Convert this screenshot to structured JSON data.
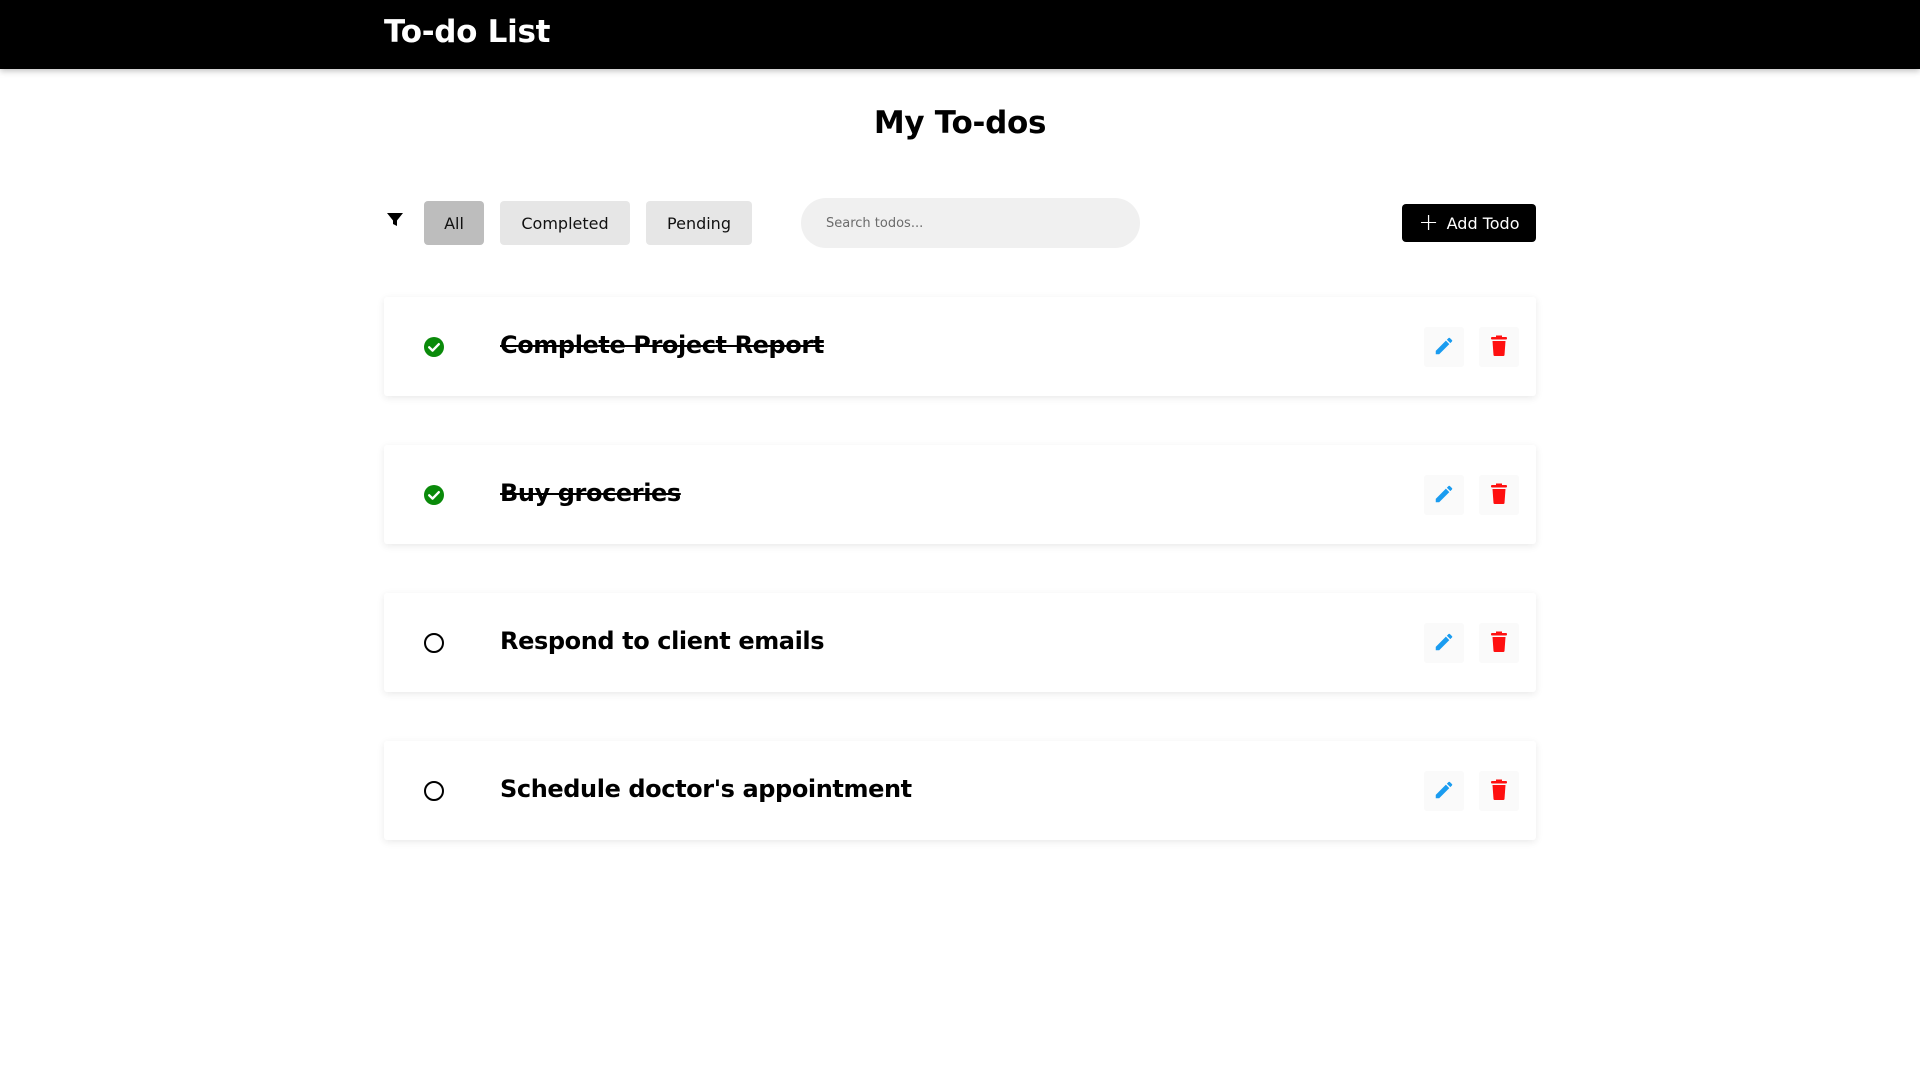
{
  "header": {
    "title": "To-do List"
  },
  "page": {
    "title": "My To-dos"
  },
  "toolbar": {
    "filter_icon": "filter-icon",
    "filters": [
      {
        "label": "All",
        "active": true
      },
      {
        "label": "Completed",
        "active": false
      },
      {
        "label": "Pending",
        "active": false
      }
    ],
    "search": {
      "placeholder": "Search todos...",
      "value": ""
    },
    "add_button": {
      "label": "Add Todo",
      "icon": "plus-icon"
    }
  },
  "todos": [
    {
      "text": "Complete Project Report",
      "completed": true
    },
    {
      "text": "Buy groceries",
      "completed": true
    },
    {
      "text": "Respond to client emails",
      "completed": false
    },
    {
      "text": "Schedule doctor's appointment",
      "completed": false
    }
  ],
  "icons": {
    "edit": "pencil-icon",
    "delete": "trash-icon",
    "done": "check-circle-icon",
    "pending": "empty-circle-icon"
  },
  "colors": {
    "header_bg": "#000000",
    "completed_check": "#0a8a0a",
    "edit_icon": "#1a9cf0",
    "delete_icon": "#ff1010",
    "filter_active_bg": "#bdbdbd",
    "filter_bg": "#e6e6e6",
    "search_bg": "#f0f0f0"
  }
}
